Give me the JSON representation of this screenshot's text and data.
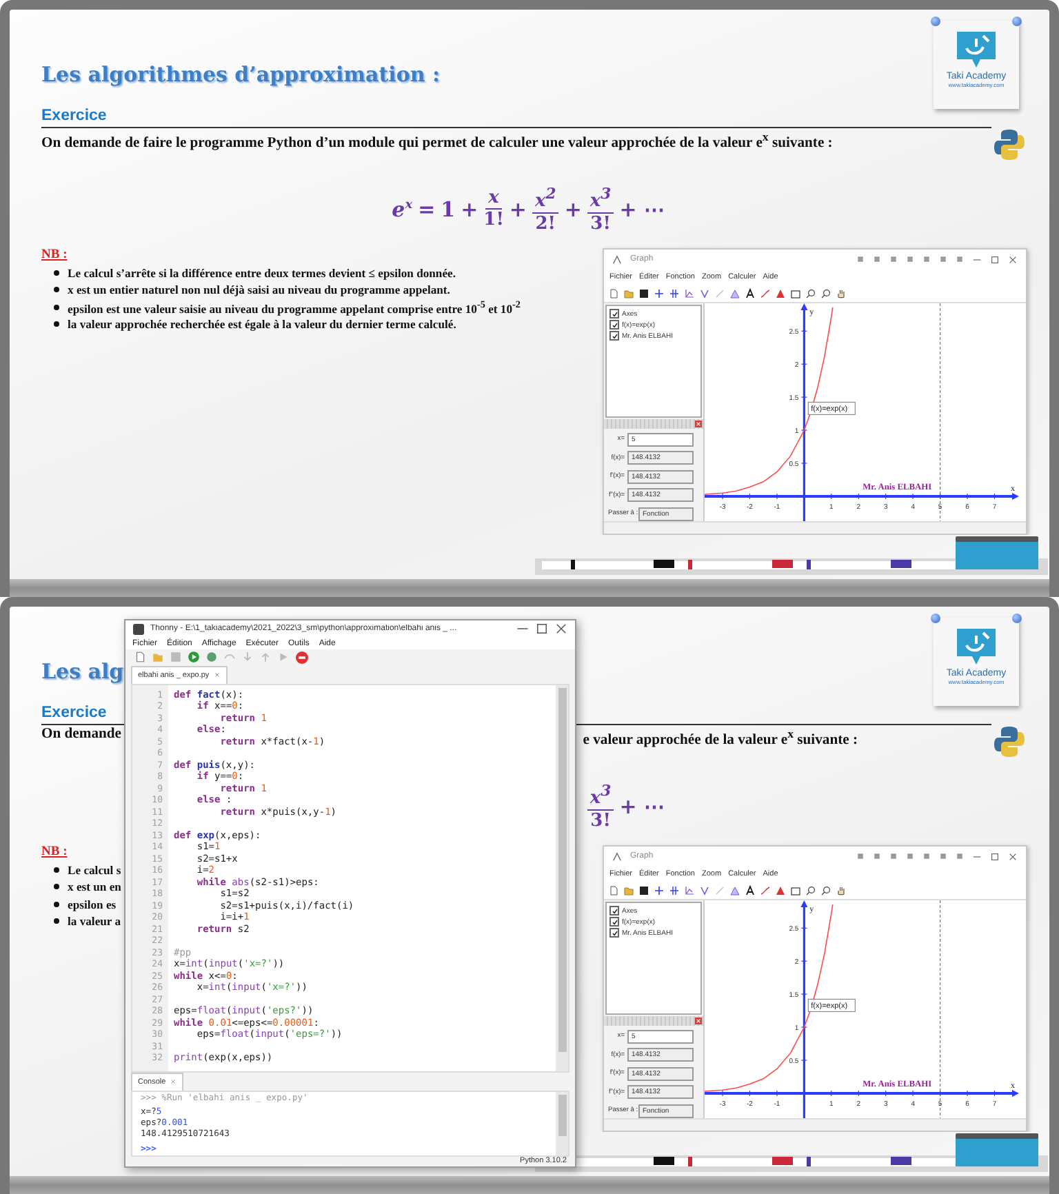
{
  "slides": [
    {
      "title": "Les algorithmes d’approximation :",
      "logo": {
        "name": "Taki Academy",
        "url": "www.takiacademy.com"
      },
      "section": "Exercice",
      "statement": [
        "On demande de faire le programme Python d’un module qui permet de calculer une valeur approchée de la valeur e$^{x}$ suivante :"
      ],
      "formula": [
        {
          "kind": "power",
          "base": "e",
          "exp": "x"
        },
        {
          "kind": "op",
          "text": "="
        },
        {
          "kind": "term",
          "text": "1"
        },
        {
          "kind": "op",
          "text": "+"
        },
        {
          "kind": "fraction",
          "num": "x",
          "den": "1!"
        },
        {
          "kind": "op",
          "text": "+"
        },
        {
          "kind": "fraction",
          "num": "x$^{2}$",
          "den": "2!"
        },
        {
          "kind": "op",
          "text": "+"
        },
        {
          "kind": "fraction",
          "num": "x$^{3}$",
          "den": "3!"
        },
        {
          "kind": "op",
          "text": "+ ⋯"
        }
      ],
      "nb_label": "NB :",
      "nb_items": [
        "Le calcul s’arrête si la différence entre deux termes devient ≤ epsilon donnée.",
        "x est un entier naturel non nul déjà saisi au niveau du programme appelant.",
        "epsilon est une valeur saisie au niveau du programme appelant comprise entre 10$^{-5}$ et 10$^{-2}$",
        "la valeur approchée recherchée est égale à la valeur du dernier terme calculé."
      ],
      "graph": {
        "title": "Graph",
        "menu": [
          "Fichier",
          "Éditer",
          "Fonction",
          "Zoom",
          "Calculer",
          "Aide"
        ],
        "objects": [
          {
            "label": "Axes",
            "checked": true
          },
          {
            "label": "f(x)=exp(x)",
            "checked": true
          },
          {
            "label": "Mr. Anis ELBAHI",
            "checked": true
          }
        ],
        "fields": [
          {
            "label": "x=",
            "value": "5"
          },
          {
            "label": "f(x)=",
            "value": "148.4132"
          },
          {
            "label": "f'(x)=",
            "value": "148.4132"
          },
          {
            "label": "f''(x)=",
            "value": "148.4132"
          }
        ],
        "goto": {
          "label": "Passer à :",
          "value": "Fonction"
        },
        "chart_data": {
          "type": "line",
          "xlabel": "x",
          "ylabel": "y",
          "x": [
            -3.66,
            -3,
            -2.5,
            -2,
            -1.5,
            -1,
            -0.5,
            0,
            0.25,
            0.5,
            0.75,
            1,
            1.05
          ],
          "xlim": [
            -3.66,
            7.9
          ],
          "ylim": [
            -0.46,
            2.92
          ],
          "series": [
            {
              "name": "f(x)=exp(x)",
              "color": "#ff4a4a",
              "values": [
                0.03,
                0.05,
                0.08,
                0.14,
                0.22,
                0.37,
                0.61,
                1,
                1.28,
                1.65,
                2.12,
                2.72,
                2.86
              ]
            }
          ],
          "xticks": [
            -3,
            -2,
            -1,
            1,
            2,
            3,
            4,
            5,
            6,
            7
          ],
          "yticks": [
            0.5,
            1,
            1.5,
            2,
            2.5
          ],
          "annotations": [
            "Mr. Anis ELBAHI"
          ]
        }
      }
    },
    {
      "title": "Les alg",
      "logo": {
        "name": "Taki Academy",
        "url": "www.takiacademy.com"
      },
      "section": "Exercice",
      "statement": [
        "On demande",
        "e valeur approchée de la valeur e$^{x}$ suivante :"
      ],
      "formula": [
        {
          "kind": "fraction",
          "num": "x$^{3}$",
          "den": "3!"
        },
        {
          "kind": "op",
          "text": "+ ⋯"
        }
      ],
      "nb_label": "NB :",
      "nb_items": [
        "Le calcul s",
        "x est un en",
        "epsilon es",
        "la valeur a"
      ],
      "graph": {
        "title": "Graph",
        "menu": [
          "Fichier",
          "Éditer",
          "Fonction",
          "Zoom",
          "Calculer",
          "Aide"
        ],
        "objects": [
          {
            "label": "Axes",
            "checked": true
          },
          {
            "label": "f(x)=exp(x)",
            "checked": true
          },
          {
            "label": "Mr. Anis ELBAHI",
            "checked": true
          }
        ],
        "fields": [
          {
            "label": "x=",
            "value": "5"
          },
          {
            "label": "f(x)=",
            "value": "148.4132"
          },
          {
            "label": "f'(x)=",
            "value": "148.4132"
          },
          {
            "label": "f''(x)=",
            "value": "148.4132"
          }
        ],
        "goto": {
          "label": "Passer à :",
          "value": "Fonction"
        },
        "chart_data": {
          "type": "line",
          "xlabel": "x",
          "ylabel": "y",
          "x": [
            -3.66,
            -3,
            -2.5,
            -2,
            -1.5,
            -1,
            -0.5,
            0,
            0.25,
            0.5,
            0.75,
            1,
            1.05
          ],
          "xlim": [
            -3.66,
            7.9
          ],
          "ylim": [
            -0.46,
            2.92
          ],
          "series": [
            {
              "name": "f(x)=exp(x)",
              "color": "#ff4a4a",
              "values": [
                0.03,
                0.05,
                0.08,
                0.14,
                0.22,
                0.37,
                0.61,
                1,
                1.28,
                1.65,
                2.12,
                2.72,
                2.86
              ]
            }
          ],
          "xticks": [
            -3,
            -2,
            -1,
            1,
            2,
            3,
            4,
            5,
            6,
            7
          ],
          "yticks": [
            0.5,
            1,
            1.5,
            2,
            2.5
          ],
          "annotations": [
            "Mr. Anis ELBAHI"
          ]
        }
      }
    }
  ],
  "thonny": {
    "title": "Thonny  -  E:\\1_takiacademy\\2021_2022\\3_sm\\python\\approximation\\elbahi anis _ ...",
    "menu": [
      "Fichier",
      "Édition",
      "Affichage",
      "Exécuter",
      "Outils",
      "Aide"
    ],
    "tab": "elbahi anis _ expo.py",
    "lines": [
      {
        "n": "1",
        "code": [
          {
            "kind": "kw",
            "text": "def "
          },
          {
            "kind": "fn",
            "text": "fact"
          },
          {
            "kind": "plain",
            "text": "(x):"
          }
        ]
      },
      {
        "n": "2",
        "code": [
          {
            "kind": "kw",
            "text": "    if "
          },
          {
            "kind": "plain",
            "text": "x=="
          },
          {
            "kind": "num",
            "text": "0"
          },
          {
            "kind": "plain",
            "text": ":"
          }
        ]
      },
      {
        "n": "3",
        "code": [
          {
            "kind": "kw",
            "text": "        return "
          },
          {
            "kind": "num",
            "text": "1"
          }
        ]
      },
      {
        "n": "4",
        "code": [
          {
            "kind": "kw",
            "text": "    else"
          },
          {
            "kind": "plain",
            "text": ":"
          }
        ]
      },
      {
        "n": "5",
        "code": [
          {
            "kind": "kw",
            "text": "        return "
          },
          {
            "kind": "plain",
            "text": "x*fact(x-"
          },
          {
            "kind": "num",
            "text": "1"
          },
          {
            "kind": "plain",
            "text": ")"
          }
        ]
      },
      {
        "n": "6"
      },
      {
        "n": "7",
        "code": [
          {
            "kind": "kw",
            "text": "def "
          },
          {
            "kind": "fn",
            "text": "puis"
          },
          {
            "kind": "plain",
            "text": "(x,y):"
          }
        ]
      },
      {
        "n": "8",
        "code": [
          {
            "kind": "kw",
            "text": "    if "
          },
          {
            "kind": "plain",
            "text": "y=="
          },
          {
            "kind": "num",
            "text": "0"
          },
          {
            "kind": "plain",
            "text": ":"
          }
        ]
      },
      {
        "n": "9",
        "code": [
          {
            "kind": "kw",
            "text": "        return "
          },
          {
            "kind": "num",
            "text": "1"
          }
        ]
      },
      {
        "n": "10",
        "code": [
          {
            "kind": "kw",
            "text": "    else "
          },
          {
            "kind": "plain",
            "text": ":"
          }
        ]
      },
      {
        "n": "11",
        "code": [
          {
            "kind": "kw",
            "text": "        return "
          },
          {
            "kind": "plain",
            "text": "x*puis(x,y-"
          },
          {
            "kind": "num",
            "text": "1"
          },
          {
            "kind": "plain",
            "text": ")"
          }
        ]
      },
      {
        "n": "12"
      },
      {
        "n": "13",
        "code": [
          {
            "kind": "kw",
            "text": "def "
          },
          {
            "kind": "fn",
            "text": "exp"
          },
          {
            "kind": "plain",
            "text": "(x,eps):"
          }
        ]
      },
      {
        "n": "14",
        "code": [
          {
            "kind": "plain",
            "text": "    s1="
          },
          {
            "kind": "num",
            "text": "1"
          }
        ]
      },
      {
        "n": "15",
        "code": [
          {
            "kind": "plain",
            "text": "    s2=s1+x"
          }
        ]
      },
      {
        "n": "16",
        "code": [
          {
            "kind": "plain",
            "text": "    i="
          },
          {
            "kind": "num",
            "text": "2"
          }
        ]
      },
      {
        "n": "17",
        "code": [
          {
            "kind": "kw",
            "text": "    while "
          },
          {
            "kind": "builtin",
            "text": "abs"
          },
          {
            "kind": "plain",
            "text": "(s2-s1)>eps:"
          }
        ]
      },
      {
        "n": "18",
        "code": [
          {
            "kind": "plain",
            "text": "        s1=s2"
          }
        ]
      },
      {
        "n": "19",
        "code": [
          {
            "kind": "plain",
            "text": "        s2=s1+puis(x,i)/fact(i)"
          }
        ]
      },
      {
        "n": "20",
        "code": [
          {
            "kind": "plain",
            "text": "        i=i+"
          },
          {
            "kind": "num",
            "text": "1"
          }
        ]
      },
      {
        "n": "21",
        "code": [
          {
            "kind": "kw",
            "text": "    return "
          },
          {
            "kind": "plain",
            "text": "s2"
          }
        ]
      },
      {
        "n": "22"
      },
      {
        "n": "23",
        "code": [
          {
            "kind": "comment",
            "text": "#pp"
          }
        ]
      },
      {
        "n": "24",
        "code": [
          {
            "kind": "plain",
            "text": "x="
          },
          {
            "kind": "builtin",
            "text": "int"
          },
          {
            "kind": "plain",
            "text": "("
          },
          {
            "kind": "builtin",
            "text": "input"
          },
          {
            "kind": "plain",
            "text": "("
          },
          {
            "kind": "str",
            "text": "'x=?'"
          },
          {
            "kind": "plain",
            "text": "))"
          }
        ]
      },
      {
        "n": "25",
        "code": [
          {
            "kind": "kw",
            "text": "while "
          },
          {
            "kind": "plain",
            "text": "x<="
          },
          {
            "kind": "num",
            "text": "0"
          },
          {
            "kind": "plain",
            "text": ":"
          }
        ]
      },
      {
        "n": "26",
        "code": [
          {
            "kind": "plain",
            "text": "    x="
          },
          {
            "kind": "builtin",
            "text": "int"
          },
          {
            "kind": "plain",
            "text": "("
          },
          {
            "kind": "builtin",
            "text": "input"
          },
          {
            "kind": "plain",
            "text": "("
          },
          {
            "kind": "str",
            "text": "'x=?'"
          },
          {
            "kind": "plain",
            "text": "))"
          }
        ]
      },
      {
        "n": "27"
      },
      {
        "n": "28",
        "code": [
          {
            "kind": "plain",
            "text": "eps="
          },
          {
            "kind": "builtin",
            "text": "float"
          },
          {
            "kind": "plain",
            "text": "("
          },
          {
            "kind": "builtin",
            "text": "input"
          },
          {
            "kind": "plain",
            "text": "("
          },
          {
            "kind": "str",
            "text": "'eps?'"
          },
          {
            "kind": "plain",
            "text": "))"
          }
        ]
      },
      {
        "n": "29",
        "code": [
          {
            "kind": "kw",
            "text": "while "
          },
          {
            "kind": "num",
            "text": "0.01"
          },
          {
            "kind": "plain",
            "text": "<=eps<="
          },
          {
            "kind": "num",
            "text": "0.00001"
          },
          {
            "kind": "plain",
            "text": ":"
          }
        ]
      },
      {
        "n": "30",
        "code": [
          {
            "kind": "plain",
            "text": "    eps="
          },
          {
            "kind": "builtin",
            "text": "float"
          },
          {
            "kind": "plain",
            "text": "("
          },
          {
            "kind": "builtin",
            "text": "input"
          },
          {
            "kind": "plain",
            "text": "("
          },
          {
            "kind": "str",
            "text": "'eps=?'"
          },
          {
            "kind": "plain",
            "text": "))"
          }
        ]
      },
      {
        "n": "31"
      },
      {
        "n": "32",
        "code": [
          {
            "kind": "builtin",
            "text": "print"
          },
          {
            "kind": "plain",
            "text": "(exp(x,eps))"
          }
        ]
      }
    ],
    "console_tab": "Console",
    "console": [
      {
        "kind": "cmd",
        "text": ">>> %Run 'elbahi anis _ expo.py'"
      },
      {
        "kind": "io",
        "prompt": "x=?",
        "input": "5"
      },
      {
        "kind": "io",
        "prompt": "eps?",
        "input": "0.001"
      },
      {
        "kind": "out",
        "text": "148.4129510721643"
      },
      {
        "kind": "prompt",
        "text": ">>>"
      }
    ],
    "status": "Python 3.10.2"
  }
}
